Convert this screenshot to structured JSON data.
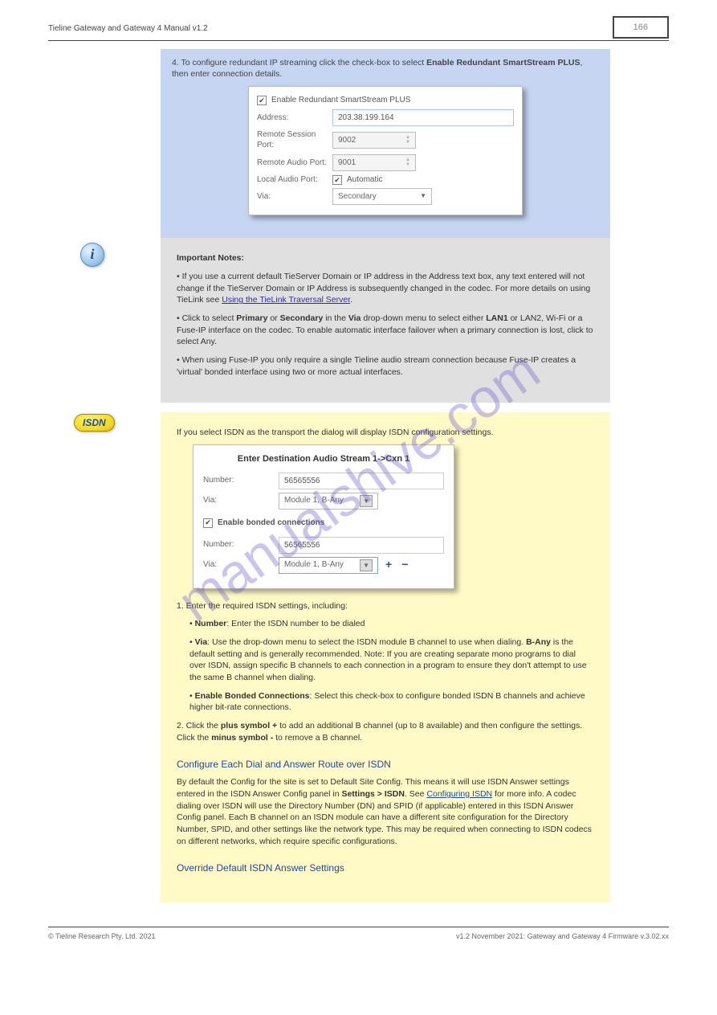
{
  "header": {
    "manual_title": "Tieline Gateway and Gateway 4 Manual v1.2",
    "page_number": "166"
  },
  "blue_section": {
    "txt1": "4. To configure redundant IP streaming click the check-box to select",
    "txt1_b": "Enable Redundant SmartStream PLUS",
    "txt1_c": ", then enter connection details.",
    "form": {
      "checkbox_label": "Enable Redundant SmartStream PLUS",
      "address_label": "Address:",
      "address_value": "203.38.199.164",
      "session_label": "Remote Session Port:",
      "session_value": "9002",
      "audio_label": "Remote Audio Port:",
      "audio_value": "9001",
      "local_label": "Local Audio Port:",
      "local_checkbox": "Automatic",
      "via_label": "Via:",
      "via_value": "Secondary"
    }
  },
  "gray_section": {
    "title": "Important Notes:",
    "note1": "If you use a current default TieServer Domain or IP address in the Address text box, any text entered will not change if the TieServer Domain or IP Address is subsequently changed in the codec. For more details on using TieLink see",
    "note1_link": "Using the TieLink Traversal Server",
    "note1_end": ".",
    "note2a": "Click to select",
    "note2b": "Primary",
    "note2c": "or",
    "note2d": "Secondary",
    "note2e": "in the",
    "note2f": "Via",
    "note2g": "drop-down menu to select either",
    "note2h": "LAN1",
    "note2i": "or",
    "note2j": "LAN2, Wi-Fi or a Fuse-IP interface on the codec. To enable automatic interface failover when a primary connection is lost, click to select Any.",
    "note3": "When using Fuse-IP you only require a single Tieline audio stream connection because Fuse-IP creates a 'virtual' bonded interface using two or more actual interfaces."
  },
  "yellow_section": {
    "intro_text": "If you select ISDN as the transport the dialog will display ISDN configuration settings.",
    "form": {
      "title": "Enter Destination Audio Stream 1->Cxn 1",
      "number_label": "Number:",
      "number1": "56565556",
      "via_label": "Via:",
      "via1": "Module 1, B-Any",
      "bonded_label": "Enable bonded connections",
      "number2": "56565556",
      "via2": "Module 1, B-Any"
    },
    "list_intro": "1. Enter the required ISDN settings, including:",
    "li1a": "Number",
    "li1b": ": Enter the ISDN number to be dialed",
    "li2a": "Via",
    "li2b": ": Use the drop-down menu to select the ISDN module B channel to use when dialing.",
    "li2c": "B-Any",
    "li2d": "is the default setting and is generally recommended. Note: If you are creating separate mono programs to dial over ISDN, assign specific B channels to each connection in a program to ensure they don't attempt to use the same B channel when dialing.",
    "li3a": "Enable Bonded Connections",
    "li3b": ": Select this check-box to configure bonded ISDN B channels and achieve higher bit-rate connections.",
    "p2a": "2. Click the",
    "p2_plus": "plus symbol +",
    "p2b": "to add an additional B channel (up to 8 available) and then configure the settings. Click the",
    "p2_minus": "minus symbol -",
    "p2c": "to remove a B channel.",
    "sub1": "Configure Each Dial and Answer Route over ISDN",
    "p3a": "By default the Config for the site is set to Default Site Config. This means it will use ISDN Answer settings entered in the ISDN Answer Config panel in",
    "p3b": "Settings > ISDN",
    "p3c": ". See",
    "p3_link": "Configuring ISDN",
    "p3d": "for more info. A codec dialing over ISDN will use the Directory Number (DN) and SPID (if applicable) entered in this ISDN Answer Config panel. Each B channel on an ISDN module can have a different site configuration for the Directory Number, SPID, and other settings like the network type. This may be required when connecting to ISDN codecs on different networks, which require specific configurations.",
    "sub2": "Override Default ISDN Answer Settings"
  },
  "footer": {
    "copyright": "© Tieline Research Pty. Ltd. 2021",
    "version": "v1.2 November 2021: Gateway and Gateway 4 Firmware v.3.02.xx"
  },
  "watermark": "manualshive.com"
}
